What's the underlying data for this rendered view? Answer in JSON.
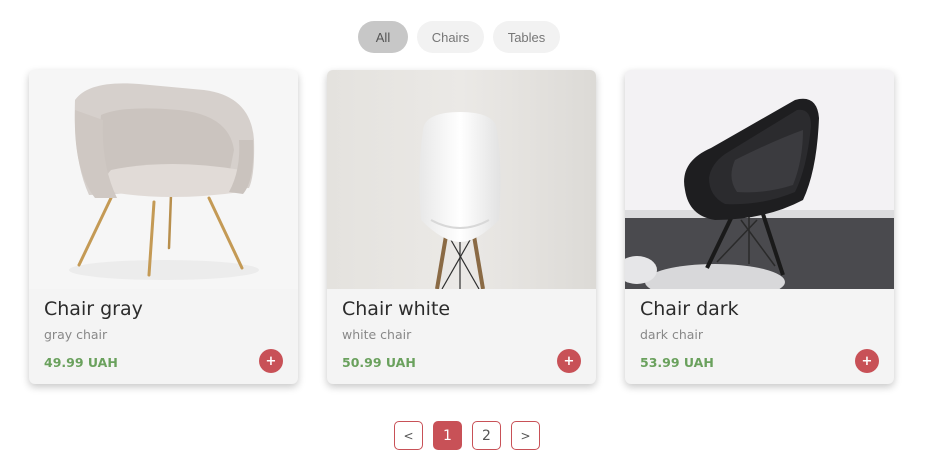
{
  "filters": [
    {
      "label": "All",
      "active": true
    },
    {
      "label": "Chairs",
      "active": false
    },
    {
      "label": "Tables",
      "active": false
    }
  ],
  "products": [
    {
      "title": "Chair gray",
      "subtitle": "gray chair",
      "price": "49.99 UAH",
      "add_label": "+"
    },
    {
      "title": "Chair white",
      "subtitle": "white chair",
      "price": "50.99 UAH",
      "add_label": "+"
    },
    {
      "title": "Chair dark",
      "subtitle": "dark chair",
      "price": "53.99 UAH",
      "add_label": "+"
    }
  ],
  "pagination": {
    "prev": "<",
    "pages": [
      "1",
      "2"
    ],
    "current": "1",
    "next": ">"
  },
  "colors": {
    "accent": "#c85157",
    "price": "#6aa15d",
    "card_bg": "#f4f4f4",
    "active_filter": "#c7c7c7"
  }
}
